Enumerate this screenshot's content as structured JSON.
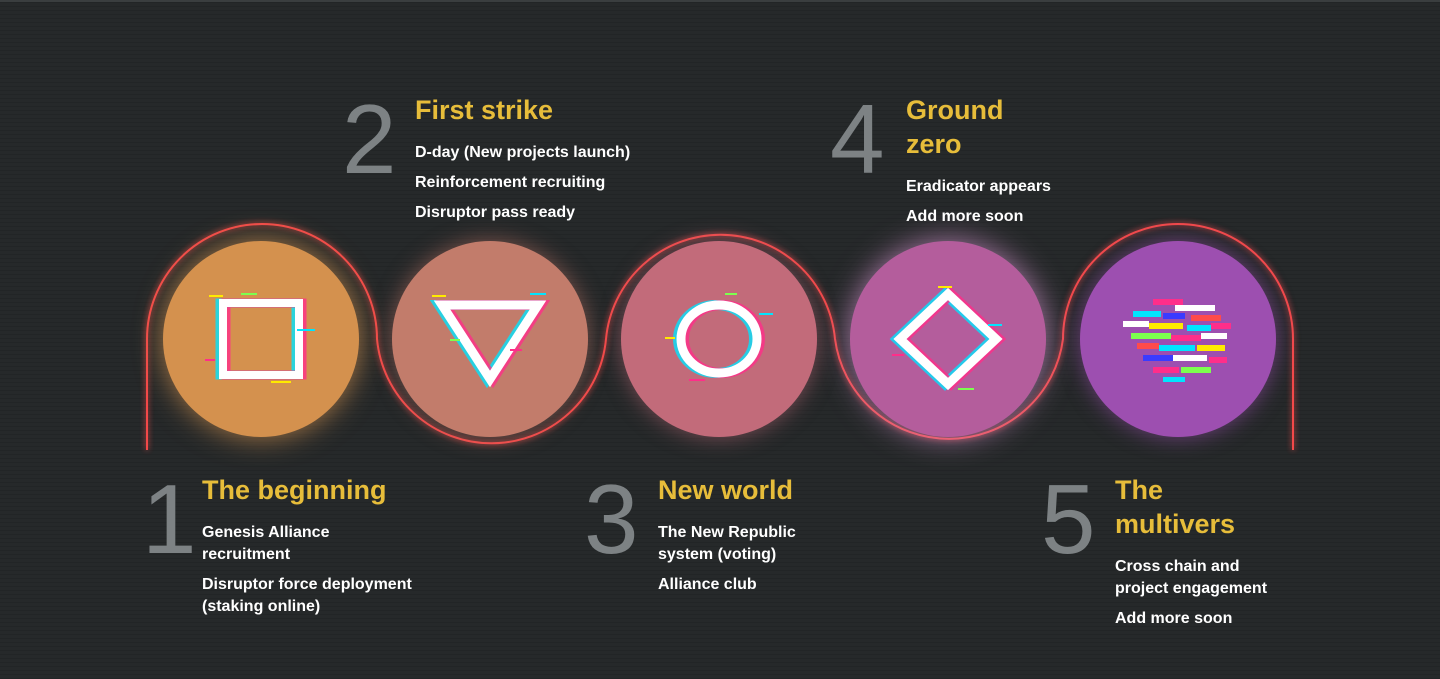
{
  "colors": {
    "background": "#26292a",
    "track": "#ff4b4b",
    "title": "#e7bd3a",
    "number": "#7d8284",
    "text": "#ffffff"
  },
  "stages": [
    {
      "number": "1",
      "title": "The beginning",
      "items": [
        "Genesis Alliance recruitment",
        "Disruptor force deployment (staking online)"
      ],
      "icon": "square-glitch-icon",
      "color": "#d4914e"
    },
    {
      "number": "2",
      "title": "First strike",
      "items": [
        "D-day (New projects launch)",
        "Reinforcement recruiting",
        "Disruptor pass ready"
      ],
      "icon": "triangle-glitch-icon",
      "color": "#c27c6b"
    },
    {
      "number": "3",
      "title": "New world",
      "items": [
        "The New Republic system (voting)",
        "Alliance club"
      ],
      "icon": "circle-glitch-icon",
      "color": "#c26b7a"
    },
    {
      "number": "4",
      "title": "Ground zero",
      "items": [
        "Eradicator appears",
        "Add more soon"
      ],
      "icon": "diamond-glitch-icon",
      "color": "#b45d9c"
    },
    {
      "number": "5",
      "title": "The multivers",
      "items": [
        "Cross chain and project engagement",
        "Add more soon"
      ],
      "icon": "noise-glitch-icon",
      "color": "#9d4fb0"
    }
  ]
}
